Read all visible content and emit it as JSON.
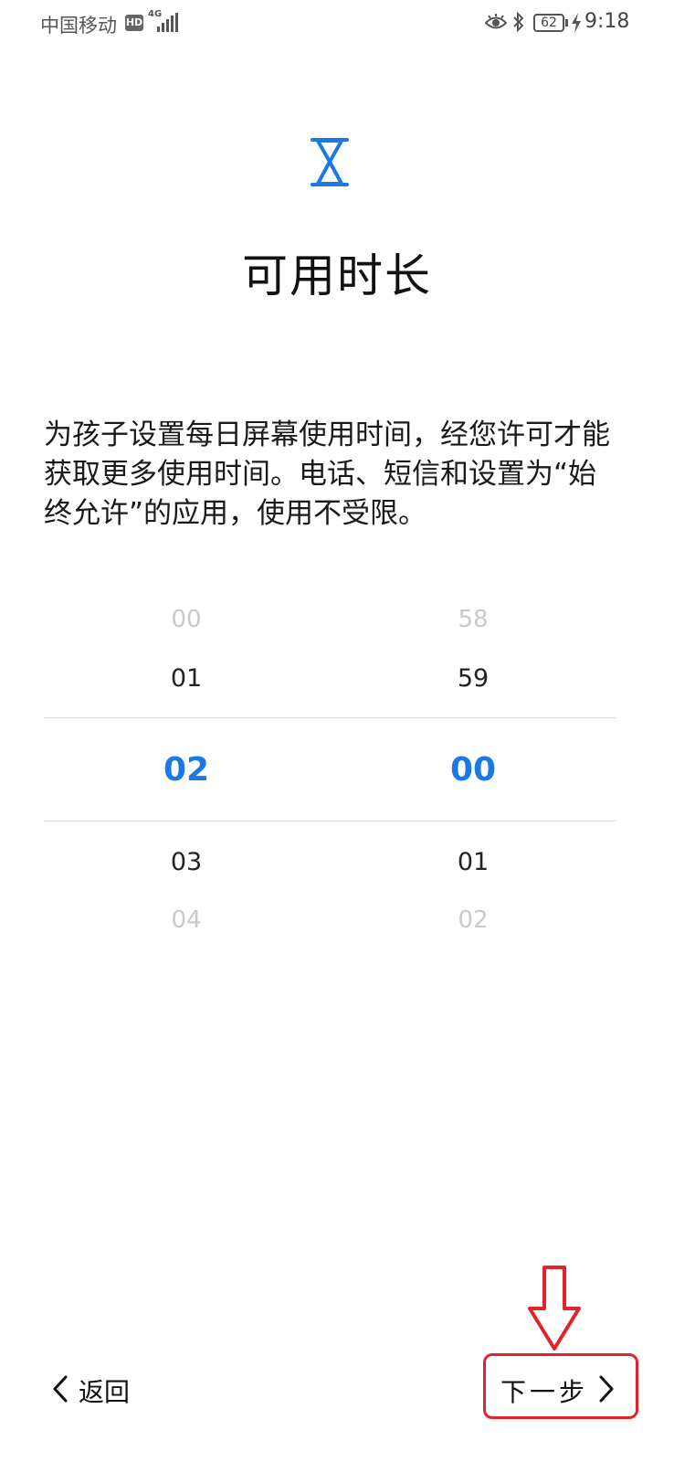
{
  "status_bar": {
    "carrier": "中国移动",
    "hd_badge": "HD",
    "network_type": "4G",
    "battery_level": "62",
    "time": "9:18"
  },
  "header": {
    "icon": "hourglass-icon",
    "title": "可用时长"
  },
  "description": "为孩子设置每日屏幕使用时间，经您许可才能获取更多使用时间。电话、短信和设置为“始终允许”的应用，使用不受限。",
  "time_picker": {
    "hours": {
      "far_above": "00",
      "above": "01",
      "selected": "02",
      "below": "03",
      "far_below": "04"
    },
    "minutes": {
      "far_above": "58",
      "above": "59",
      "selected": "00",
      "below": "01",
      "far_below": "02"
    }
  },
  "nav": {
    "back_label": "返回",
    "next_label": "下一步"
  },
  "colors": {
    "accent": "#1a7ae2",
    "annotation": "#e3232c"
  }
}
